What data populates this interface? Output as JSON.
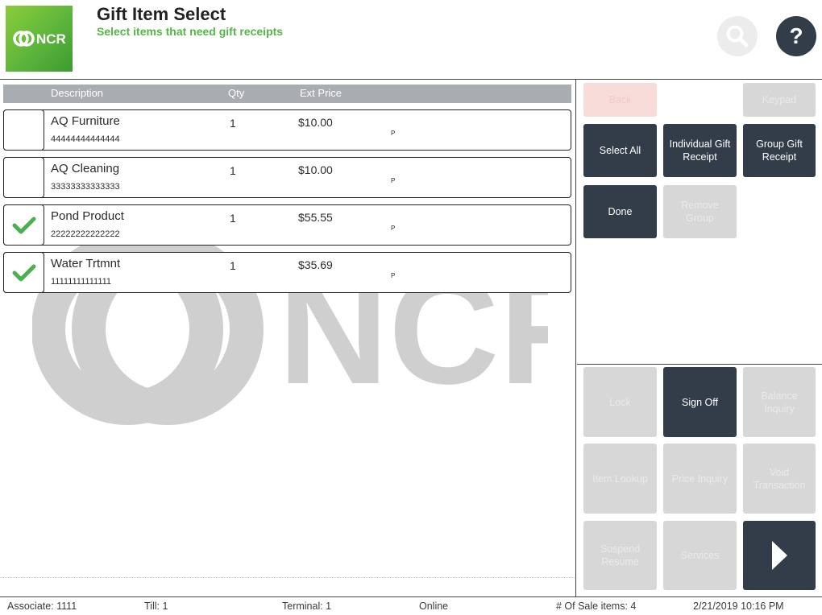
{
  "header": {
    "logo_text": "NCR",
    "title": "Gift Item Select",
    "subtitle": "Select items that need gift receipts",
    "help_label": "?"
  },
  "table": {
    "columns": [
      "Description",
      "Qty",
      "Ext Price"
    ],
    "rows": [
      {
        "description": "AQ Furniture",
        "code": "44444444444444",
        "qty": "1",
        "price": "$10.00",
        "flag": "P",
        "checked": false
      },
      {
        "description": "AQ Cleaning",
        "code": "33333333333333",
        "qty": "1",
        "price": "$10.00",
        "flag": "P",
        "checked": false
      },
      {
        "description": "Pond Product",
        "code": "22222222222222",
        "qty": "1",
        "price": "$55.55",
        "flag": "P",
        "checked": true
      },
      {
        "description": "Water Trtmnt",
        "code": "11111111111111",
        "qty": "1",
        "price": "$35.69",
        "flag": "P",
        "checked": true
      }
    ]
  },
  "actions": {
    "back": "Back",
    "keypad": "Keypad",
    "select_all": "Select All",
    "individual_gift_receipt": "Individual Gift Receipt",
    "group_gift_receipt": "Group Gift Receipt",
    "done": "Done",
    "remove_group": "Remove Group"
  },
  "functions": {
    "lock": "Lock",
    "sign_off": "Sign Off",
    "balance_inquiry": "Balance Inquiry",
    "item_lookup": "Item Lookup",
    "price_inquiry": "Price Inquiry",
    "void_transaction": "Void Transaction",
    "suspend_resume": "Suspend Resume",
    "services": "Services"
  },
  "status": {
    "associate": "Associate: 1111",
    "till": "Till: 1",
    "terminal": "Terminal: 1",
    "connection": "Online",
    "sale_items": "# Of Sale items: 4",
    "datetime": "2/21/2019 10:16 PM"
  },
  "colors": {
    "accent_green": "#55b548",
    "dark_button": "#333d49",
    "disabled_button": "#d7d7d7",
    "check_green": "#4caf50"
  }
}
